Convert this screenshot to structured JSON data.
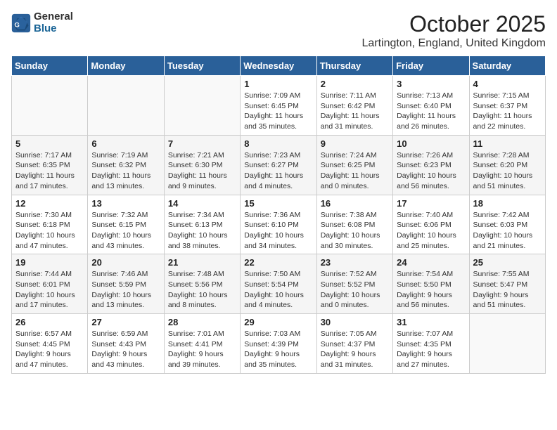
{
  "logo": {
    "general": "General",
    "blue": "Blue"
  },
  "title": "October 2025",
  "location": "Lartington, England, United Kingdom",
  "weekdays": [
    "Sunday",
    "Monday",
    "Tuesday",
    "Wednesday",
    "Thursday",
    "Friday",
    "Saturday"
  ],
  "weeks": [
    [
      {
        "day": "",
        "content": ""
      },
      {
        "day": "",
        "content": ""
      },
      {
        "day": "",
        "content": ""
      },
      {
        "day": "1",
        "content": "Sunrise: 7:09 AM\nSunset: 6:45 PM\nDaylight: 11 hours\nand 35 minutes."
      },
      {
        "day": "2",
        "content": "Sunrise: 7:11 AM\nSunset: 6:42 PM\nDaylight: 11 hours\nand 31 minutes."
      },
      {
        "day": "3",
        "content": "Sunrise: 7:13 AM\nSunset: 6:40 PM\nDaylight: 11 hours\nand 26 minutes."
      },
      {
        "day": "4",
        "content": "Sunrise: 7:15 AM\nSunset: 6:37 PM\nDaylight: 11 hours\nand 22 minutes."
      }
    ],
    [
      {
        "day": "5",
        "content": "Sunrise: 7:17 AM\nSunset: 6:35 PM\nDaylight: 11 hours\nand 17 minutes."
      },
      {
        "day": "6",
        "content": "Sunrise: 7:19 AM\nSunset: 6:32 PM\nDaylight: 11 hours\nand 13 minutes."
      },
      {
        "day": "7",
        "content": "Sunrise: 7:21 AM\nSunset: 6:30 PM\nDaylight: 11 hours\nand 9 minutes."
      },
      {
        "day": "8",
        "content": "Sunrise: 7:23 AM\nSunset: 6:27 PM\nDaylight: 11 hours\nand 4 minutes."
      },
      {
        "day": "9",
        "content": "Sunrise: 7:24 AM\nSunset: 6:25 PM\nDaylight: 11 hours\nand 0 minutes."
      },
      {
        "day": "10",
        "content": "Sunrise: 7:26 AM\nSunset: 6:23 PM\nDaylight: 10 hours\nand 56 minutes."
      },
      {
        "day": "11",
        "content": "Sunrise: 7:28 AM\nSunset: 6:20 PM\nDaylight: 10 hours\nand 51 minutes."
      }
    ],
    [
      {
        "day": "12",
        "content": "Sunrise: 7:30 AM\nSunset: 6:18 PM\nDaylight: 10 hours\nand 47 minutes."
      },
      {
        "day": "13",
        "content": "Sunrise: 7:32 AM\nSunset: 6:15 PM\nDaylight: 10 hours\nand 43 minutes."
      },
      {
        "day": "14",
        "content": "Sunrise: 7:34 AM\nSunset: 6:13 PM\nDaylight: 10 hours\nand 38 minutes."
      },
      {
        "day": "15",
        "content": "Sunrise: 7:36 AM\nSunset: 6:10 PM\nDaylight: 10 hours\nand 34 minutes."
      },
      {
        "day": "16",
        "content": "Sunrise: 7:38 AM\nSunset: 6:08 PM\nDaylight: 10 hours\nand 30 minutes."
      },
      {
        "day": "17",
        "content": "Sunrise: 7:40 AM\nSunset: 6:06 PM\nDaylight: 10 hours\nand 25 minutes."
      },
      {
        "day": "18",
        "content": "Sunrise: 7:42 AM\nSunset: 6:03 PM\nDaylight: 10 hours\nand 21 minutes."
      }
    ],
    [
      {
        "day": "19",
        "content": "Sunrise: 7:44 AM\nSunset: 6:01 PM\nDaylight: 10 hours\nand 17 minutes."
      },
      {
        "day": "20",
        "content": "Sunrise: 7:46 AM\nSunset: 5:59 PM\nDaylight: 10 hours\nand 13 minutes."
      },
      {
        "day": "21",
        "content": "Sunrise: 7:48 AM\nSunset: 5:56 PM\nDaylight: 10 hours\nand 8 minutes."
      },
      {
        "day": "22",
        "content": "Sunrise: 7:50 AM\nSunset: 5:54 PM\nDaylight: 10 hours\nand 4 minutes."
      },
      {
        "day": "23",
        "content": "Sunrise: 7:52 AM\nSunset: 5:52 PM\nDaylight: 10 hours\nand 0 minutes."
      },
      {
        "day": "24",
        "content": "Sunrise: 7:54 AM\nSunset: 5:50 PM\nDaylight: 9 hours\nand 56 minutes."
      },
      {
        "day": "25",
        "content": "Sunrise: 7:55 AM\nSunset: 5:47 PM\nDaylight: 9 hours\nand 51 minutes."
      }
    ],
    [
      {
        "day": "26",
        "content": "Sunrise: 6:57 AM\nSunset: 4:45 PM\nDaylight: 9 hours\nand 47 minutes."
      },
      {
        "day": "27",
        "content": "Sunrise: 6:59 AM\nSunset: 4:43 PM\nDaylight: 9 hours\nand 43 minutes."
      },
      {
        "day": "28",
        "content": "Sunrise: 7:01 AM\nSunset: 4:41 PM\nDaylight: 9 hours\nand 39 minutes."
      },
      {
        "day": "29",
        "content": "Sunrise: 7:03 AM\nSunset: 4:39 PM\nDaylight: 9 hours\nand 35 minutes."
      },
      {
        "day": "30",
        "content": "Sunrise: 7:05 AM\nSunset: 4:37 PM\nDaylight: 9 hours\nand 31 minutes."
      },
      {
        "day": "31",
        "content": "Sunrise: 7:07 AM\nSunset: 4:35 PM\nDaylight: 9 hours\nand 27 minutes."
      },
      {
        "day": "",
        "content": ""
      }
    ]
  ]
}
